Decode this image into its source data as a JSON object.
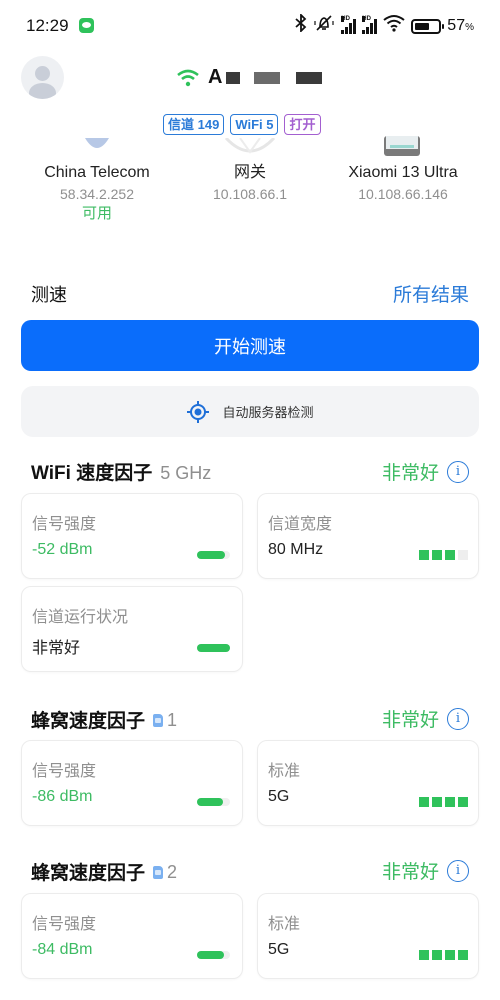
{
  "status_bar": {
    "time": "12:29",
    "notification_icon": "wechat-icon",
    "icons": [
      "bluetooth-icon",
      "mute-icon",
      "hd-signal-icon",
      "hd-signal-icon",
      "wifi-icon",
      "battery-icon"
    ],
    "battery_level": "57",
    "battery_unit": "%"
  },
  "header": {
    "avatar_icon": "user-avatar-icon",
    "wifi_icon": "wifi-icon",
    "ssid_visible": "A",
    "badges": [
      {
        "label": "信道 149",
        "color": "#2b7bd8"
      },
      {
        "label": "WiFi 5",
        "color": "#2b7bd8"
      },
      {
        "label": "打开",
        "color": "#a35fd0"
      }
    ]
  },
  "devices": [
    {
      "name": "China Telecom",
      "ip": "58.34.2.252",
      "status": "可用"
    },
    {
      "name": "网关",
      "ip": "10.108.66.1",
      "status": ""
    },
    {
      "name": "Xiaomi 13 Ultra",
      "ip": "10.108.66.146",
      "status": ""
    }
  ],
  "speedtest": {
    "section_label": "测速",
    "all_results_link": "所有结果",
    "start_button": "开始测速",
    "auto_server_button": "自动服务器检测"
  },
  "wifi_factor": {
    "title": "WiFi 速度因子",
    "band": "5 GHz",
    "status": "非常好",
    "cards": [
      {
        "label": "信号强度",
        "value": "-52 dBm",
        "indicator": "pill",
        "level": 0.85,
        "value_color": "green"
      },
      {
        "label": "信道宽度",
        "value": "80 MHz",
        "indicator": "blocks",
        "level": 3,
        "max": 4,
        "value_color": "dark"
      },
      {
        "label": "信道运行状况",
        "value": "非常好",
        "indicator": "pill",
        "level": 1.0,
        "value_color": "dark"
      }
    ]
  },
  "cellular_factors": [
    {
      "title": "蜂窝速度因子",
      "sim": "1",
      "status": "非常好",
      "cards": [
        {
          "label": "信号强度",
          "value": "-86 dBm",
          "indicator": "pill",
          "level": 0.8,
          "value_color": "green"
        },
        {
          "label": "标准",
          "value": "5G",
          "indicator": "blocks",
          "level": 4,
          "max": 4,
          "value_color": "dark"
        }
      ]
    },
    {
      "title": "蜂窝速度因子",
      "sim": "2",
      "status": "非常好",
      "cards": [
        {
          "label": "信号强度",
          "value": "-84 dBm",
          "indicator": "pill",
          "level": 0.82,
          "value_color": "green"
        },
        {
          "label": "标准",
          "value": "5G",
          "indicator": "blocks",
          "level": 4,
          "max": 4,
          "value_color": "dark"
        }
      ]
    }
  ],
  "colors": {
    "accent": "#0a6dfb",
    "link": "#2b7bd8",
    "good": "#3dbb63",
    "indicator": "#2fc25b"
  }
}
